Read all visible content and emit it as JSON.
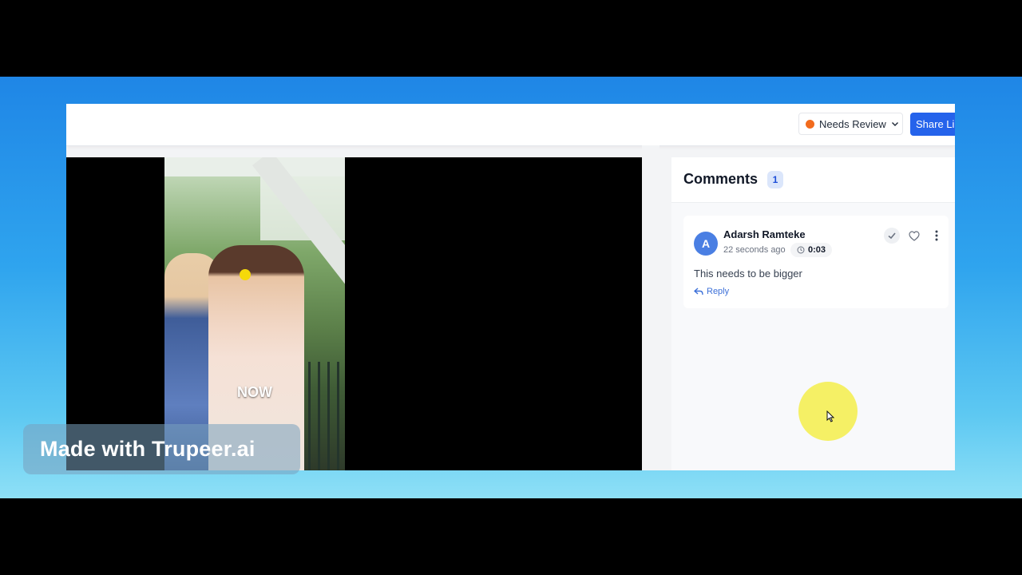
{
  "header": {
    "status": {
      "label": "Needs Review",
      "dot_color": "#f26b1d"
    },
    "share_label": "Share Lin"
  },
  "video": {
    "overlay_text": "NOW"
  },
  "comments": {
    "title": "Comments",
    "count": "1",
    "items": [
      {
        "avatar_initial": "A",
        "author": "Adarsh Ramteke",
        "time_ago": "22 seconds ago",
        "timestamp": "0:03",
        "body": "This needs to be bigger",
        "reply_label": "Reply"
      }
    ]
  },
  "watermark": {
    "text": "Made with Trupeer.ai"
  },
  "colors": {
    "accent": "#2563eb",
    "status": "#f26b1d",
    "highlight": "#f5ef4a"
  }
}
